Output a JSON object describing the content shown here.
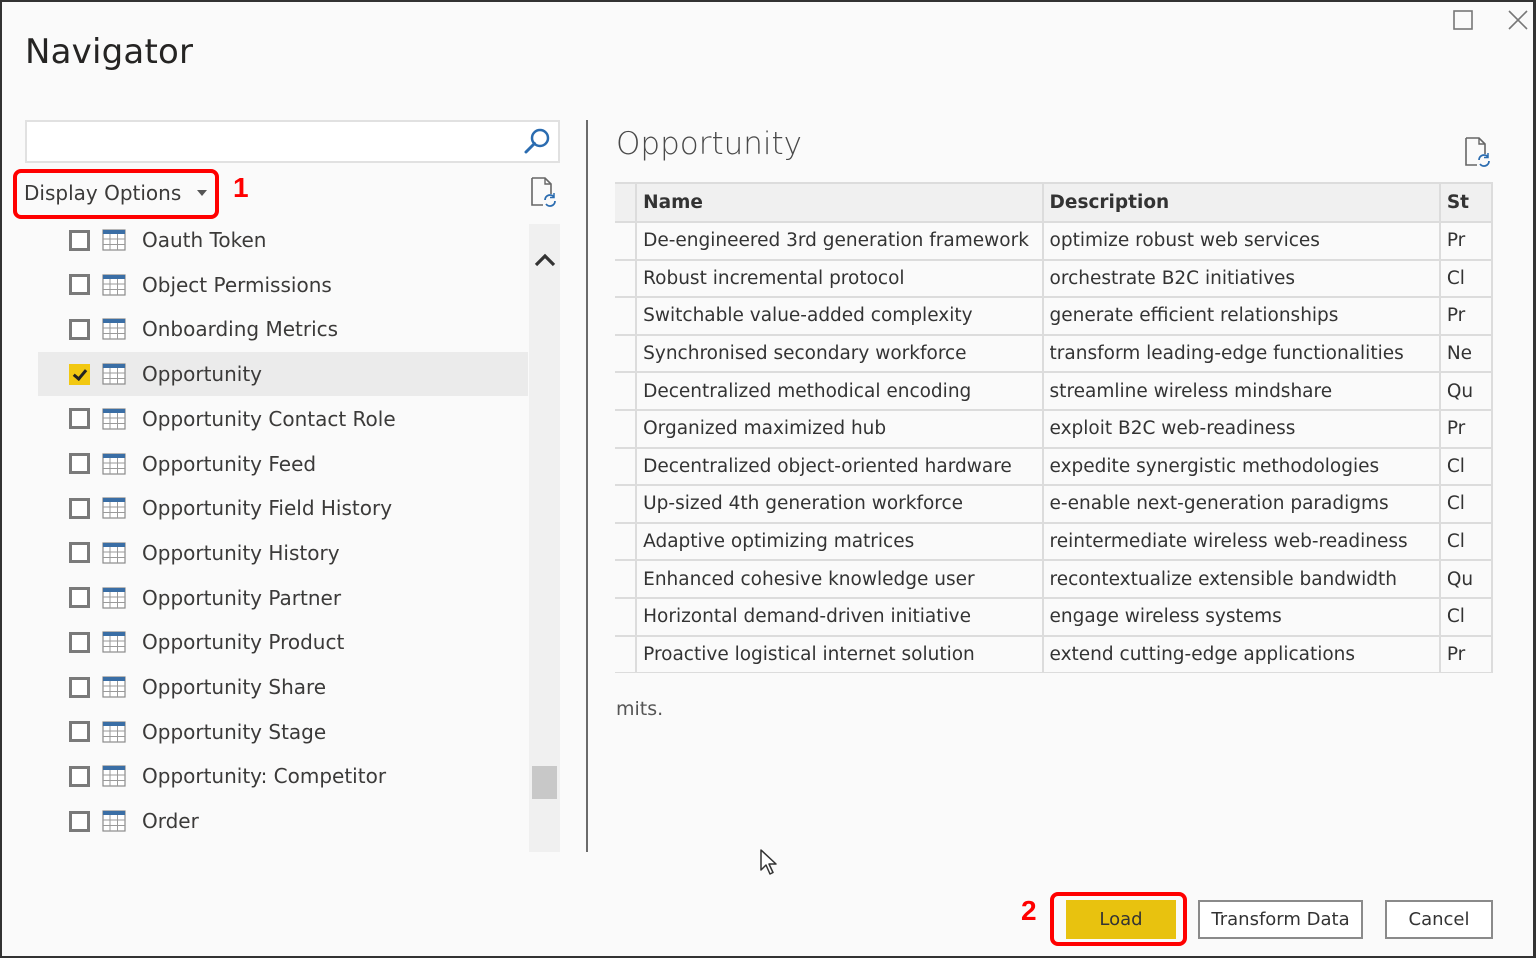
{
  "window": {
    "title": "Navigator",
    "controls": [
      "maximize",
      "close"
    ]
  },
  "left_panel": {
    "search": {
      "value": "",
      "placeholder": ""
    },
    "display_options_label": "Display Options",
    "annotation_1": "1",
    "items": [
      {
        "label": "Oauth Token",
        "checked": false,
        "icon": "table-icon"
      },
      {
        "label": "Object Permissions",
        "checked": false,
        "icon": "table-icon"
      },
      {
        "label": "Onboarding Metrics",
        "checked": false,
        "icon": "table-icon"
      },
      {
        "label": "Opportunity",
        "checked": true,
        "selected": true,
        "icon": "table-icon"
      },
      {
        "label": "Opportunity Contact Role",
        "checked": false,
        "icon": "table-icon"
      },
      {
        "label": "Opportunity Feed",
        "checked": false,
        "icon": "table-icon"
      },
      {
        "label": "Opportunity Field History",
        "checked": false,
        "icon": "table-icon"
      },
      {
        "label": "Opportunity History",
        "checked": false,
        "icon": "table-icon"
      },
      {
        "label": "Opportunity Partner",
        "checked": false,
        "icon": "table-icon"
      },
      {
        "label": "Opportunity Product",
        "checked": false,
        "icon": "table-icon"
      },
      {
        "label": "Opportunity Share",
        "checked": false,
        "icon": "table-icon"
      },
      {
        "label": "Opportunity Stage",
        "checked": false,
        "icon": "table-icon"
      },
      {
        "label": "Opportunity: Competitor",
        "checked": false,
        "icon": "table-icon"
      },
      {
        "label": "Order",
        "checked": false,
        "icon": "table-icon"
      }
    ]
  },
  "preview": {
    "title": "Opportunity",
    "columns": [
      "Name",
      "Description",
      "St"
    ],
    "rows": [
      [
        "De-engineered 3rd generation framework",
        "optimize robust web services",
        "Pr"
      ],
      [
        "Robust incremental protocol",
        "orchestrate B2C initiatives",
        "Cl"
      ],
      [
        "Switchable value-added complexity",
        "generate efficient relationships",
        "Pr"
      ],
      [
        "Synchronised secondary workforce",
        "transform leading-edge functionalities",
        "Ne"
      ],
      [
        "Decentralized methodical encoding",
        "streamline wireless mindshare",
        "Qu"
      ],
      [
        "Organized maximized hub",
        "exploit B2C web-readiness",
        "Pr"
      ],
      [
        "Decentralized object-oriented hardware",
        "expedite synergistic methodologies",
        "Cl"
      ],
      [
        "Up-sized 4th generation workforce",
        "e-enable next-generation paradigms",
        "Cl"
      ],
      [
        "Adaptive optimizing matrices",
        "reintermediate wireless web-readiness",
        "Cl"
      ],
      [
        "Enhanced cohesive knowledge user",
        "recontextualize extensible bandwidth",
        "Qu"
      ],
      [
        "Horizontal demand-driven initiative",
        "engage wireless systems",
        "Cl"
      ],
      [
        "Proactive logistical internet solution",
        "extend cutting-edge applications",
        "Pr"
      ]
    ],
    "note": "mits."
  },
  "footer": {
    "annotation_2": "2",
    "load_label": "Load",
    "transform_label": "Transform Data",
    "cancel_label": "Cancel"
  },
  "colors": {
    "accent_yellow": "#f2c811",
    "annotation_red": "#ff0000",
    "icon_blue": "#3a6ea5"
  }
}
